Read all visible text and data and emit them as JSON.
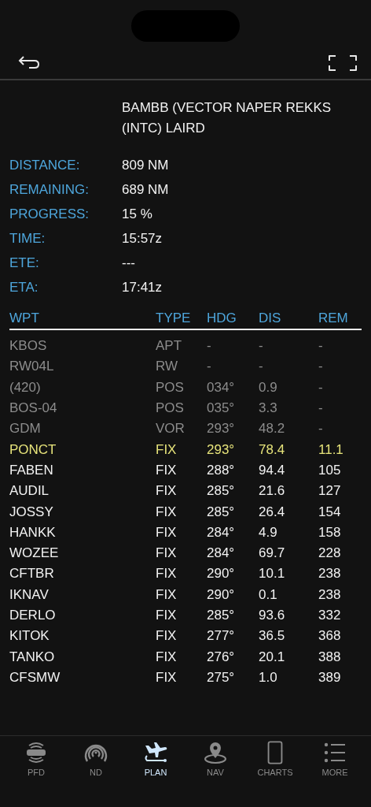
{
  "route": "BAMBB (VECTOR NAPER REKKS (INTC) LAIRD",
  "summary": [
    {
      "label": "DISTANCE:",
      "value": "809 NM"
    },
    {
      "label": "REMAINING:",
      "value": "689 NM"
    },
    {
      "label": "PROGRESS:",
      "value": "15 %"
    },
    {
      "label": "TIME:",
      "value": "15:57z"
    },
    {
      "label": "ETE:",
      "value": "---"
    },
    {
      "label": "ETA:",
      "value": "17:41z"
    }
  ],
  "table": {
    "columns": [
      "WPT",
      "TYPE",
      "HDG",
      "DIS",
      "REM"
    ],
    "rows": [
      {
        "kind": "passed",
        "cells": [
          "KBOS",
          "APT",
          "-",
          "-",
          "-"
        ]
      },
      {
        "kind": "passed",
        "cells": [
          "RW04L",
          "RW",
          "-",
          "-",
          "-"
        ]
      },
      {
        "kind": "passed",
        "cells": [
          "(420)",
          "POS",
          "034°",
          "0.9",
          "-"
        ]
      },
      {
        "kind": "passed",
        "cells": [
          "BOS-04",
          "POS",
          "035°",
          "3.3",
          "-"
        ]
      },
      {
        "kind": "passed",
        "cells": [
          "GDM",
          "VOR",
          "293°",
          "48.2",
          "-"
        ]
      },
      {
        "kind": "active",
        "cells": [
          "PONCT",
          "FIX",
          "293°",
          "78.4",
          "11.1"
        ]
      },
      {
        "kind": "upcoming",
        "cells": [
          "FABEN",
          "FIX",
          "288°",
          "94.4",
          "105"
        ]
      },
      {
        "kind": "upcoming",
        "cells": [
          "AUDIL",
          "FIX",
          "285°",
          "21.6",
          "127"
        ]
      },
      {
        "kind": "upcoming",
        "cells": [
          "JOSSY",
          "FIX",
          "285°",
          "26.4",
          "154"
        ]
      },
      {
        "kind": "upcoming",
        "cells": [
          "HANKK",
          "FIX",
          "284°",
          "4.9",
          "158"
        ]
      },
      {
        "kind": "upcoming",
        "cells": [
          "WOZEE",
          "FIX",
          "284°",
          "69.7",
          "228"
        ]
      },
      {
        "kind": "upcoming",
        "cells": [
          "CFTBR",
          "FIX",
          "290°",
          "10.1",
          "238"
        ]
      },
      {
        "kind": "upcoming",
        "cells": [
          "IKNAV",
          "FIX",
          "290°",
          "0.1",
          "238"
        ]
      },
      {
        "kind": "upcoming",
        "cells": [
          "DERLO",
          "FIX",
          "285°",
          "93.6",
          "332"
        ]
      },
      {
        "kind": "upcoming",
        "cells": [
          "KITOK",
          "FIX",
          "277°",
          "36.5",
          "368"
        ]
      },
      {
        "kind": "upcoming",
        "cells": [
          "TANKO",
          "FIX",
          "276°",
          "20.1",
          "388"
        ]
      },
      {
        "kind": "upcoming",
        "cells": [
          "CFSMW",
          "FIX",
          "275°",
          "1.0",
          "389"
        ]
      }
    ]
  },
  "tabs": [
    {
      "label": "PFD",
      "selected": false
    },
    {
      "label": "ND",
      "selected": false
    },
    {
      "label": "PLAN",
      "selected": true
    },
    {
      "label": "NAV",
      "selected": false
    },
    {
      "label": "CHARTS",
      "selected": false
    },
    {
      "label": "MORE",
      "selected": false
    }
  ]
}
